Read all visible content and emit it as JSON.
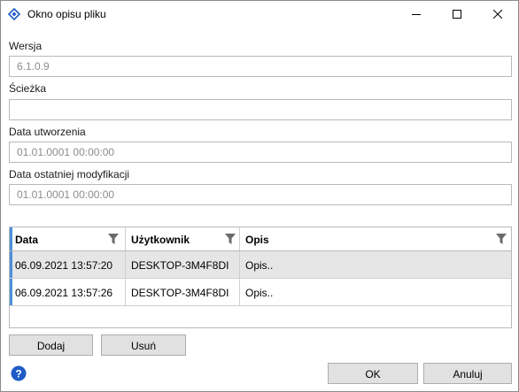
{
  "window": {
    "title": "Okno opisu pliku",
    "icon": "app-diamond-icon",
    "controls": {
      "minimize": "minimize-icon",
      "maximize": "maximize-icon",
      "close": "close-icon"
    }
  },
  "form": {
    "version": {
      "label": "Wersja",
      "value": "6.1.0.9"
    },
    "path": {
      "label": "Ścieżka",
      "value": ""
    },
    "created": {
      "label": "Data utworzenia",
      "value": "01.01.0001 00:00:00"
    },
    "modified": {
      "label": "Data ostatniej modyfikacji",
      "value": "01.01.0001 00:00:00"
    }
  },
  "grid": {
    "columns": [
      "Data",
      "Użytkownik",
      "Opis"
    ],
    "rows": [
      {
        "date": "06.09.2021 13:57:20",
        "user": "DESKTOP-3M4F8DI",
        "desc": "Opis..",
        "selected": true
      },
      {
        "date": "06.09.2021 13:57:26",
        "user": "DESKTOP-3M4F8DI",
        "desc": "Opis..",
        "selected": false
      }
    ]
  },
  "buttons": {
    "add": "Dodaj",
    "remove": "Usuń",
    "ok": "OK",
    "cancel": "Anuluj"
  },
  "colors": {
    "accent": "#4a90d9",
    "selected_row": "#e6e6e6",
    "button_face": "#e1e1e1",
    "help_icon": "#1e5bc6"
  }
}
